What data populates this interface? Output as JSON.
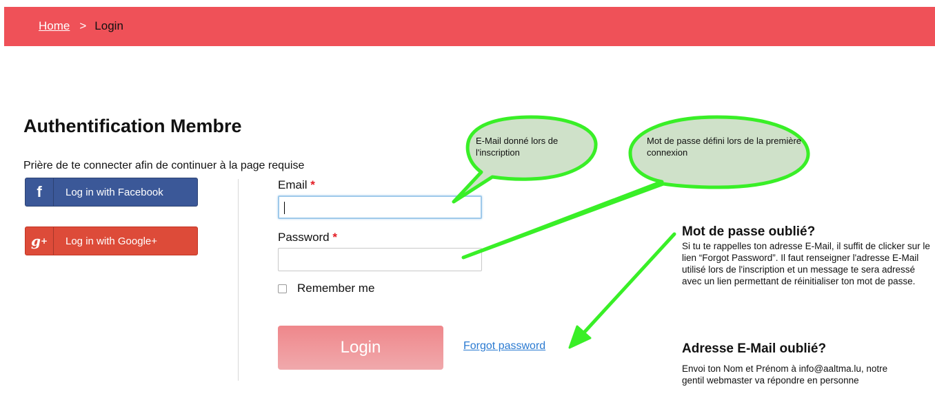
{
  "breadcrumb": {
    "home": "Home",
    "separator": ">",
    "current": "Login"
  },
  "page": {
    "title": "Authentification Membre",
    "intro": "Prière de te connecter afin de continuer à la page requise"
  },
  "social": {
    "facebook": {
      "icon": "f",
      "label": "Log in with Facebook"
    },
    "google": {
      "icon": "g",
      "icon_sup": "+",
      "label": "Log in with Google+"
    }
  },
  "form": {
    "email_label": "Email",
    "password_label": "Password",
    "required_mark": "*",
    "email_value": "",
    "password_value": "",
    "remember_label": "Remember me",
    "remember_checked": false,
    "login_label": "Login",
    "forgot_label": "Forgot password"
  },
  "callouts": {
    "email": "E-Mail donné lors de l'inscription",
    "password": "Mot de passe défini  lors de la première connexion"
  },
  "help": {
    "forgot_password_title": "Mot de passe oublié?",
    "forgot_password_text": "Si tu te rappelles ton adresse E-Mail, il suffit de clicker sur le lien “Forgot Password”. Il faut renseigner l'adresse E-Mail utilisé lors de l'inscription et un message te sera adressé avec un lien permettant de réinitialiser ton mot de passe.",
    "forgot_email_title": "Adresse E-Mail oublié?",
    "forgot_email_text": "Envoi ton Nom et Prénom à info@aaltma.lu, notre gentil webmaster va répondre en personne"
  },
  "colors": {
    "header_bar": "#ef5158",
    "facebook": "#3b5898",
    "google": "#dd4b39",
    "login_button": "#ef878b",
    "link": "#2a7ad1",
    "annotation_green": "#39ef27",
    "bubble_fill": "#cfe1c9"
  },
  "icons": [
    "facebook-icon",
    "google-plus-icon",
    "checkbox-icon"
  ]
}
